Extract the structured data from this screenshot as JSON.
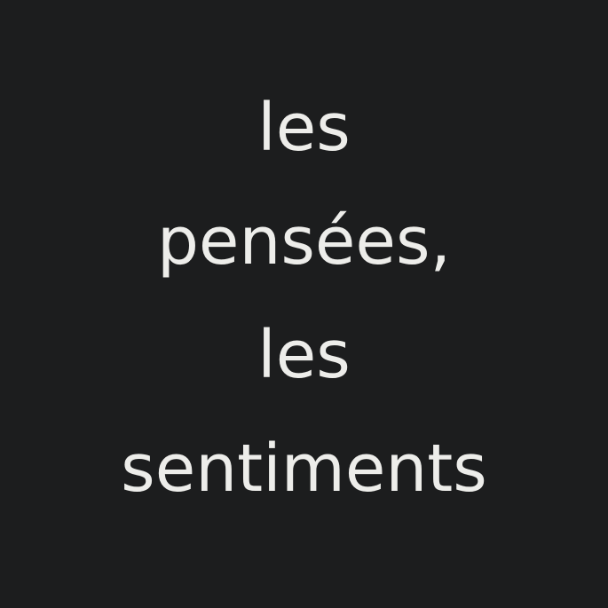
{
  "text": {
    "lines": [
      "les",
      "pensées,",
      "les",
      "sentiments"
    ]
  },
  "colors": {
    "background": "#1c1d1e",
    "text": "#ededea"
  }
}
